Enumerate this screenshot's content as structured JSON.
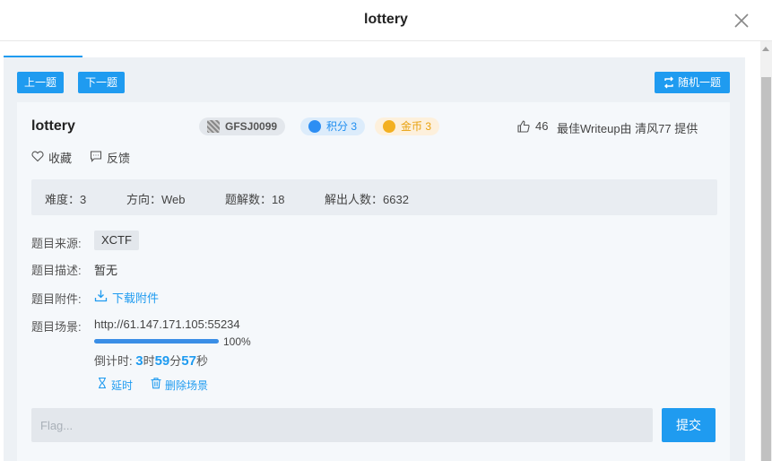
{
  "modal": {
    "title": "lottery"
  },
  "nav": {
    "prev_label": "上一题",
    "next_label": "下一题",
    "random_label": "随机一题"
  },
  "challenge": {
    "title": "lottery",
    "id_tag": "GFSJ0099",
    "score_tag": "积分 3",
    "coin_tag": "金币 3",
    "likes": "46",
    "writeup_text": "最佳Writeup由 清风77 提供",
    "favorite_label": "收藏",
    "feedback_label": "反馈"
  },
  "stats": {
    "difficulty": "难度：3",
    "direction": "方向：Web",
    "writeups": "题解数：18",
    "solvers": "解出人数：6632"
  },
  "fields": {
    "source_label": "题目来源:",
    "source_value": "XCTF",
    "desc_label": "题目描述:",
    "desc_value": "暂无",
    "attach_label": "题目附件:",
    "attach_link": "下载附件",
    "scene_label": "题目场景:",
    "scene_url": "http://61.147.171.105:55234",
    "progress_text": "100%",
    "progress_fraction": 1.0,
    "countdown_prefix": "倒计时: ",
    "countdown_h": "3",
    "countdown_h_unit": "时",
    "countdown_m": "59",
    "countdown_m_unit": "分",
    "countdown_s": "57",
    "countdown_s_unit": "秒",
    "extend_label": "延时",
    "delete_label": "删除场景"
  },
  "flag": {
    "placeholder": "Flag...",
    "submit_label": "提交"
  },
  "colors": {
    "accent": "#1f9bf0",
    "coin": "#e8a10e",
    "background": "#edf1f5"
  },
  "icons": [
    "close-icon",
    "shuffle-icon",
    "thumbs-up-icon",
    "heart-icon",
    "comment-icon",
    "download-icon",
    "hourglass-icon",
    "trash-icon",
    "star-badge-icon",
    "coin-icon",
    "qr-icon"
  ]
}
